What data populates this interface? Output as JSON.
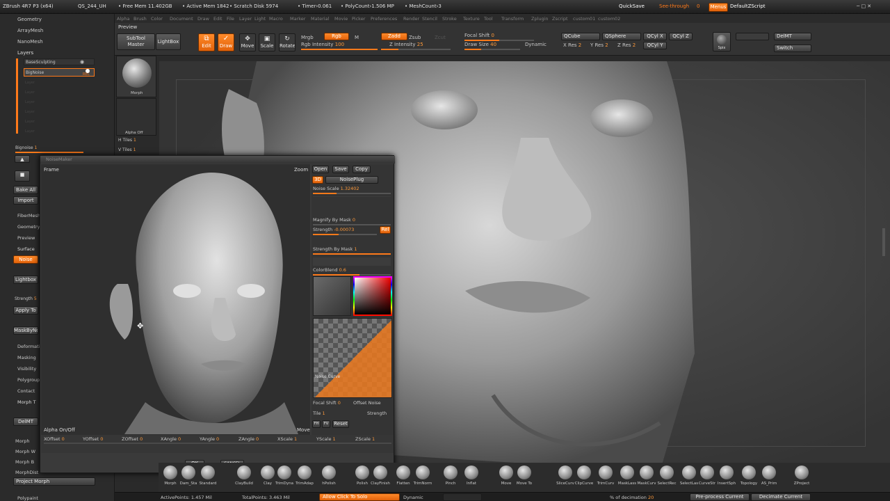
{
  "titlebar": {
    "app": "ZBrush 4R7 P3 (x64)",
    "project": "QS_244_UH",
    "free_mem": "• Free Mem 11.402GB",
    "active_mem": "• Active Mem 1842",
    "scratch": "• Scratch Disk 5974",
    "timer": "• Timer›0.061",
    "polycount": "• PolyCount›1.506 MP",
    "meshcount": "• MeshCount›3",
    "quicksave": "QuickSave",
    "seethrough": "See-through",
    "seethrough_val": "0",
    "menus": "Menus",
    "script": "DefaultZScript"
  },
  "menubar": [
    "Alpha",
    "Brush",
    "Color",
    "Document",
    "Draw",
    "Edit",
    "File",
    "Layer",
    "Light",
    "Macro",
    "Marker",
    "Material",
    "Movie",
    "Picker",
    "Preferences",
    "Render",
    "Stencil",
    "Stroke",
    "Texture",
    "Tool",
    "Transform",
    "Zplugin",
    "Zscript",
    "custom01",
    "custom02"
  ],
  "toolbar": {
    "preview": "Preview",
    "subtool_master": "SubTool Master",
    "lightbox": "LightBox",
    "edit": "Edit",
    "draw": "Draw",
    "move": "Move",
    "scale": "Scale",
    "rotate": "Rotate",
    "mrgb": "Mrgb",
    "rgb": "Rgb",
    "m": "M",
    "rgb_intensity": "Rgb Intensity",
    "rgb_intensity_val": "100",
    "zadd": "Zadd",
    "zsub": "Zsub",
    "zcut": "Zcut",
    "z_intensity": "Z Intensity",
    "z_intensity_val": "25",
    "focal_shift": "Focal Shift",
    "focal_shift_val": "0",
    "draw_size": "Draw Size",
    "draw_size_val": "40",
    "dynamic": "Dynamic",
    "qcube": "QCube",
    "qsphere": "QSphere",
    "qcylx": "QCyl X",
    "qcylz": "QCyl Z",
    "qcyly": "QCyl Y",
    "xres": "X Res",
    "xres_val": "2",
    "yres": "Y Res",
    "yres_val": "2",
    "zres": "Z Res",
    "zres_val": "2",
    "spix": "Spix",
    "delmt": "DelMT",
    "switch": "Switch"
  },
  "leftpanel": {
    "geometry": "Geometry",
    "arraymesh": "ArrayMesh",
    "nanomesh": "NanoMesh",
    "layers": "Layers",
    "layer1": "BaseSculpting",
    "layer2": "BigNoise",
    "rec": "REC",
    "layer_ghost": [
      "Layer",
      "Layer",
      "Layer",
      "Layer",
      "Layer",
      "Layer"
    ],
    "bignoise": "Bignoise",
    "bignoise_val": "1",
    "bake_all": "Bake All",
    "import": "Import",
    "fibermesh": "FiberMesh",
    "geometryhd": "GeometryHD",
    "preview": "Preview",
    "surface": "Surface",
    "noise": "Noise",
    "lightbox": "Lightbox",
    "strength": "Strength",
    "strength_val": "5",
    "apply": "Apply To",
    "masknoise": "MaskByNoise",
    "deformation": "Deformation",
    "masking": "Masking",
    "visibility": "Visibility",
    "polygroups": "Polygroups",
    "contact": "Contact",
    "morph_target": "Morph T",
    "delmt": "DelMT",
    "morph": "Morph",
    "morph_w": "Morph W",
    "morph_b": "Morph B",
    "morphdist": "MorphDist",
    "project_morph": "Project Morph",
    "polypaint": "Polypaint"
  },
  "toolpreview": {
    "morph_label": "Morph",
    "alpha_off": "Alpha Off",
    "htiles": "H Tiles",
    "htiles_val": "1",
    "vtiles": "V Tiles",
    "vtiles_val": "1"
  },
  "dialog": {
    "title": "NoiseMaker",
    "frame": "Frame",
    "zoom": "Zoom",
    "move": "Move",
    "alpha_onoff": "Alpha On/Off",
    "open": "Open",
    "save": "Save",
    "copy": "Copy",
    "btn3d": "3D",
    "noiseplug": "NoisePlug",
    "noise_scale": "Noise Scale",
    "noise_scale_val": "1.32402",
    "magnify_mask": "Magnify By Mask",
    "magnify_mask_val": "0",
    "strength": "Strength",
    "strength_val": "-0.00073",
    "rel": "Rel",
    "strength_mask": "Strength By Mask",
    "strength_mask_val": "1",
    "colorblend": "ColorBlend",
    "colorblend_val": "0.6",
    "noise_curve": "Noise Curve",
    "focal_shift": "Focal Shift",
    "focal_shift_val": "0",
    "offset_noise": "Offset Noise",
    "tile": "Tile",
    "tile_val": "1",
    "strength2": "Strength",
    "fh": "FH",
    "fv": "FV",
    "reset": "Reset",
    "xoffset": "XOffset",
    "xoffset_val": "0",
    "yoffset": "YOffset",
    "yoffset_val": "0",
    "zoffset": "ZOffset",
    "zoffset_val": "0",
    "xangle": "XAngle",
    "xangle_val": "0",
    "yangle": "YAngle",
    "yangle_val": "0",
    "zangle": "ZAngle",
    "zangle_val": "0",
    "xscale": "XScale",
    "xscale_val": "1",
    "yscale": "YScale",
    "yscale_val": "1",
    "zscale": "ZScale",
    "zscale_val": "1",
    "ok": "OK",
    "cancel": "CANCEL"
  },
  "shelf": [
    "Morph",
    "Dam_Sta",
    "Standard",
    "ClayBuild",
    "Clay",
    "TrimDyna",
    "TrimAdap",
    "hPolish",
    "Polish",
    "ClayFinish",
    "Flatten",
    "TrimNorm",
    "Pinch",
    "Inflat",
    "Move",
    "Move To",
    "SliceCurv",
    "ClipCurve",
    "TrimCurv",
    "MaskLass",
    "MaskCurv",
    "SelectRec",
    "SelectLas",
    "CurveStr",
    "InsertSph",
    "Topology",
    "AS_Prim",
    "ZProject"
  ],
  "status": {
    "active_points": "ActivePoints: 1.457 Mil",
    "total_points": "TotalPoints: 3.463 Mil",
    "allow_solo": "Allow Click To Solo",
    "dynamic": "Dynamic",
    "decimation": "% of decimation",
    "decimation_val": "20",
    "preprocess": "Pre-process Current",
    "decimate": "Decimate Current"
  },
  "colors": {
    "accent": "#ff7a1a",
    "panel": "#2b2b2b",
    "viewport": "#3f3f3f"
  }
}
